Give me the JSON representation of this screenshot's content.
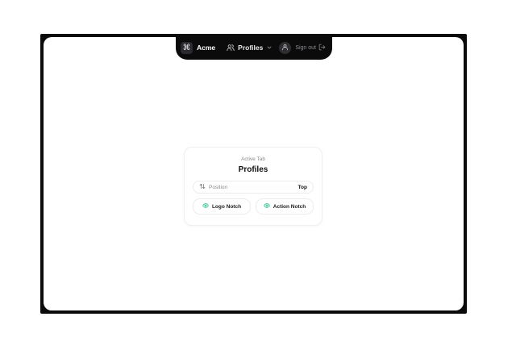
{
  "notch": {
    "brand": "Acme",
    "tab_label": "Profiles",
    "signout_label": "Sign out"
  },
  "card": {
    "subtitle": "Active Tab",
    "title": "Profiles",
    "position_label": "Position",
    "position_value": "Top",
    "logo_notch_label": "Logo Notch",
    "action_notch_label": "Action Notch"
  },
  "colors": {
    "frame": "#0b0b0c",
    "accent_eye": "#10b981"
  },
  "icons": {
    "logo": "command-icon",
    "profiles": "users-icon",
    "chevron": "chevron-down-icon",
    "avatar": "user-icon",
    "signout": "log-out-icon",
    "position": "arrow-up-down-icon",
    "eye": "eye-icon"
  }
}
